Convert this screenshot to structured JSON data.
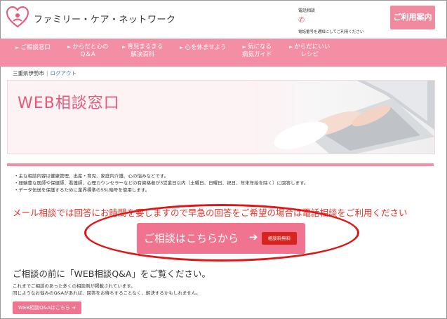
{
  "header": {
    "logo_text": "ファミリー・ケア・ネットワーク",
    "tel_label": "電話相談",
    "tel_note": "電話番号を通知にしてご利用ください",
    "guide_button": "ご利用案内"
  },
  "nav": {
    "items": [
      {
        "line1": "ご相談窓口",
        "line2": ""
      },
      {
        "line1": "からだと心の",
        "line2": "Q＆A"
      },
      {
        "line1": "育児まるまる",
        "line2": "解決百科"
      },
      {
        "line1": "心を休ませよう",
        "line2": ""
      },
      {
        "line1": "気になる",
        "line2": "病気ガイド"
      },
      {
        "line1": "からだにいい",
        "line2": "レシピ"
      }
    ]
  },
  "breadcrumb": {
    "city": "三重県伊勢市",
    "logout": "ログアウト"
  },
  "banner": {
    "title": "WEB相談窓口"
  },
  "content": {
    "bullets": [
      "主な相談内容は健康管理、出産・育児、家庭内介護、心の悩みなどです。",
      "経験豊な医師や保健師、看護師、心理カウンセラーなどの有資格者が3営業日以内（土曜日、日曜日、祝日、年末年始を除く）に回答します。",
      "データ伝送を保護するために業界標準のSSL暗号を使用します。"
    ],
    "notice": "メール相談では回答にお時間を要しますので早急の回答をご希望の場合は電話相談をご利用ください",
    "consult_button": "ご相談はこちらから",
    "free_badge": "相談料無料",
    "qa_heading": "ご相談の前に「WEB相談Q&A」をご覧ください。",
    "qa_text_1": "これまでご相談のあった多くの相談例が掲載されています。",
    "qa_text_2": "同じようなお悩みのQ&Aがあれば、回答をお待ちすることなく、解決するかもしれません。",
    "qa_button": "WEB相談Q&Aはこちら"
  },
  "colors": {
    "accent_pink": "#f38ea5",
    "button_pink": "#f0738f",
    "title_pink": "#e8577a",
    "notice_red": "#e8332a",
    "badge_red": "#d8231f",
    "annotation_red": "#e01515"
  },
  "icons": [
    "heart-logo-icon",
    "phone-icon",
    "chevron-right-icon",
    "arrow-right-icon"
  ]
}
